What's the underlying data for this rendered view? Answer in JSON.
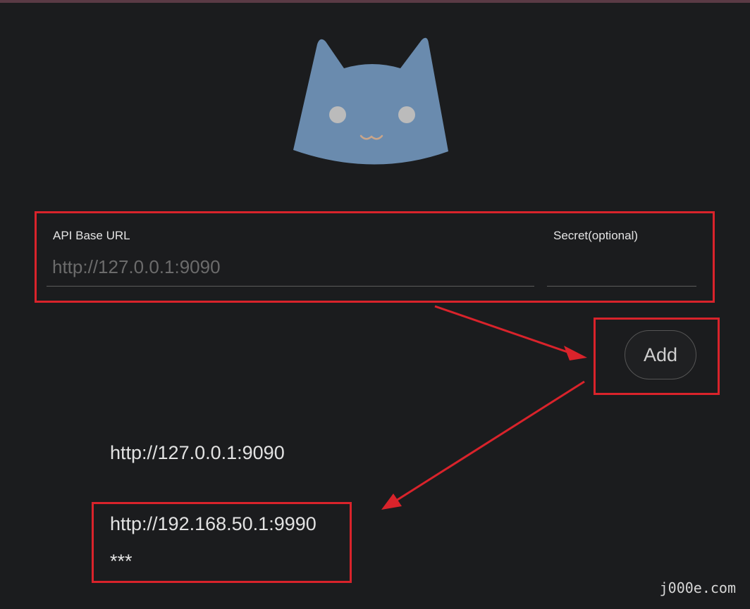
{
  "form": {
    "url_label": "API Base URL",
    "url_placeholder": "http://127.0.0.1:9090",
    "url_value": "",
    "secret_label": "Secret(optional)",
    "secret_value": ""
  },
  "actions": {
    "add_label": "Add"
  },
  "backends": [
    {
      "url": "http://127.0.0.1:9090"
    },
    {
      "url": "http://192.168.50.1:9990",
      "secret_mask": "***"
    }
  ],
  "watermark": "j000e.com",
  "colors": {
    "background": "#1b1c1e",
    "logo": "#6a8bae",
    "annotation_red": "#d9232b"
  },
  "icons": {
    "logo": "cat-logo-icon"
  }
}
